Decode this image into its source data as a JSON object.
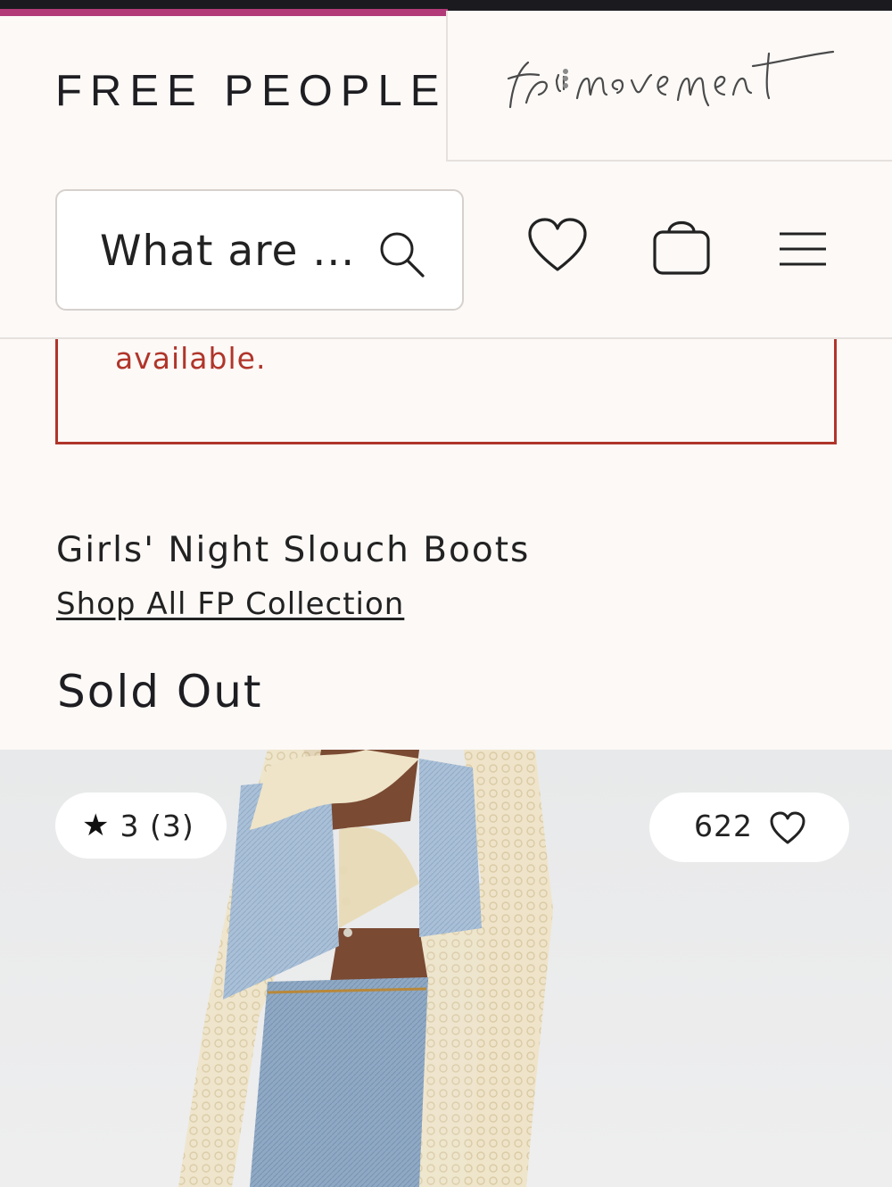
{
  "header": {
    "brand": "FREE PEOPLE",
    "movement_logo_text": "fp movement"
  },
  "search": {
    "placeholder": "What are ..."
  },
  "icons": {
    "search": "search-icon",
    "wishlist": "heart-icon",
    "cart": "bag-icon",
    "menu": "hamburger-menu-icon"
  },
  "alert": {
    "text": "available."
  },
  "product": {
    "title": "Girls' Night Slouch Boots",
    "collection_link": "Shop All FP Collection",
    "status": "Sold Out"
  },
  "image_overlay": {
    "rating": "3 (3)",
    "likes": "622"
  },
  "colors": {
    "accent": "#b23a79",
    "alert": "#b0352a",
    "background": "#fcf9f7"
  }
}
